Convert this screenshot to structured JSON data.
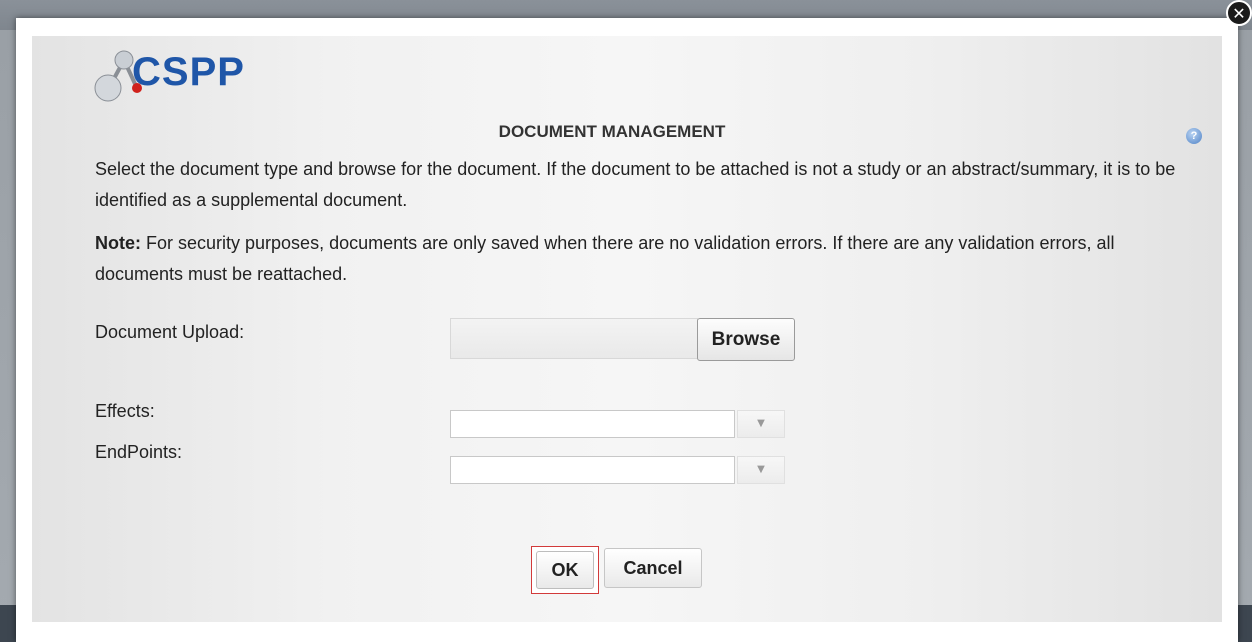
{
  "app": {
    "logo_text": "CSPP"
  },
  "dialog": {
    "title": "DOCUMENT MANAGEMENT",
    "instructions": "Select the document type and browse for the document. If the document to be attached is not a study or an abstract/summary, it is to be identified as a supplemental document.",
    "note_label": "Note:",
    "note_text": " For security purposes, documents are only saved when there are no validation errors. If there are any validation errors, all documents must be reattached.",
    "close_label": "✕"
  },
  "form": {
    "upload_label": "Document Upload:",
    "browse_label": "Browse",
    "upload_value": "",
    "effects_label": "Effects:",
    "effects_value": "",
    "endpoints_label": "EndPoints:",
    "endpoints_value": ""
  },
  "buttons": {
    "ok": "OK",
    "cancel": "Cancel"
  },
  "icons": {
    "help": "help-icon",
    "close": "close-icon",
    "logo": "molecule-logo-icon",
    "dropdown": "chevron-down-icon"
  },
  "colors": {
    "brand": "#1f56a8",
    "focus_border": "#d23a3a",
    "close_bg": "#1b1b1b"
  }
}
